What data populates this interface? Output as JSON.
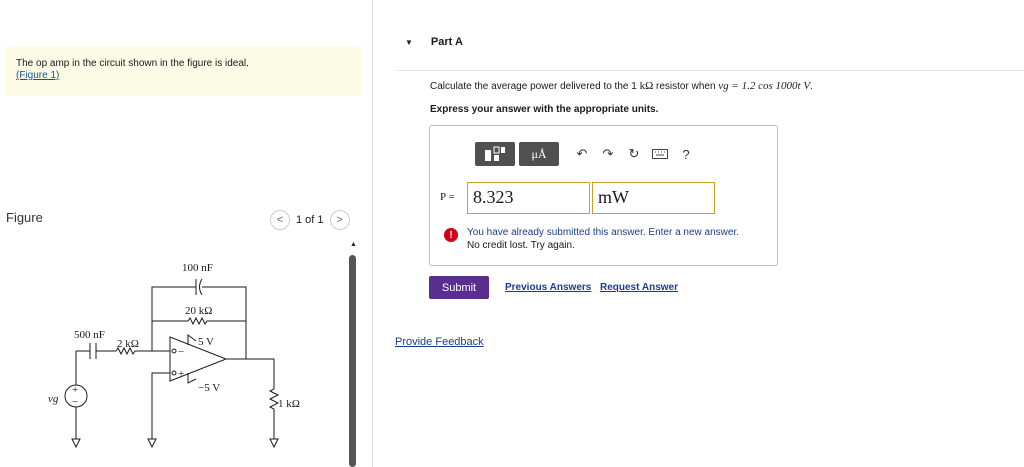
{
  "left": {
    "prompt_text": "The op amp in the circuit shown in the figure is ideal.",
    "figure_link": "(Figure 1)",
    "figure_title": "Figure",
    "pager": {
      "text": "1 of 1",
      "prev": "<",
      "next": ">"
    },
    "circuit": {
      "cap_top": "100 nF",
      "res_feedback": "20 kΩ",
      "cap_in": "500 nF",
      "res_in": "2 kΩ",
      "vpos": "5 V",
      "vneg": "−5 V",
      "res_load": "1 kΩ",
      "source": "vg",
      "plus": "+",
      "minus": "−"
    }
  },
  "part": {
    "title": "Part A",
    "question_prefix": "Calculate the average power delivered to the 1 ",
    "question_unit": "kΩ",
    "question_mid": " resistor when ",
    "question_expr": "vg = 1.2 cos 1000t V",
    "question_end": ".",
    "instruction": "Express your answer with the appropriate units.",
    "toolbar": {
      "units_label": "μÅ",
      "help_label": "?"
    },
    "p_label": "P =",
    "answer_value": "8.323",
    "answer_unit": "mW",
    "warning_line1": "You have already submitted this answer. Enter a new answer.",
    "warning_line2": "No credit lost. Try again.",
    "submit_label": "Submit",
    "previous_answers": "Previous Answers",
    "request_answer": "Request Answer",
    "provide_feedback": "Provide Feedback"
  }
}
